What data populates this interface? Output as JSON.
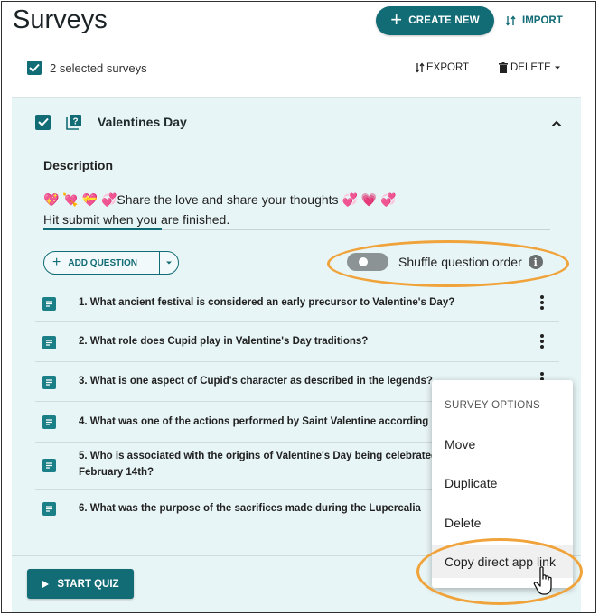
{
  "header": {
    "title": "Surveys",
    "create_label": "CREATE NEW",
    "import_label": "IMPORT"
  },
  "toolbar": {
    "selected_text": "2 selected surveys",
    "export_label": "EXPORT",
    "delete_label": "DELETE"
  },
  "survey": {
    "title": "Valentines Day",
    "description_label": "Description",
    "description_line1": "💖 💘 💝 💞Share the love and share your thoughts 💞 💗 💞",
    "description_line2": "Hit submit when you are finished.",
    "add_question_label": "ADD QUESTION",
    "shuffle_label": "Shuffle question order",
    "shuffle_on": false,
    "questions": [
      "1. What ancient festival is considered an early precursor to Valentine's Day?",
      "2. What role does Cupid play in Valentine's Day traditions?",
      "3. What is one aspect of Cupid's character as described in the legends?",
      "4. What was one of the actions performed by Saint Valentine according",
      "5. Who is associated with the origins of Valentine's Day being celebrated on February 14th?",
      "6. What was the purpose of the sacrifices made during the Lupercalia"
    ],
    "start_label": "START QUIZ"
  },
  "menu": {
    "header": "SURVEY OPTIONS",
    "items": [
      "Move",
      "Duplicate",
      "Delete",
      "Copy direct app link"
    ]
  },
  "colors": {
    "accent": "#126c75",
    "card_bg": "#e8f5f6",
    "highlight": "#f0a33a"
  }
}
